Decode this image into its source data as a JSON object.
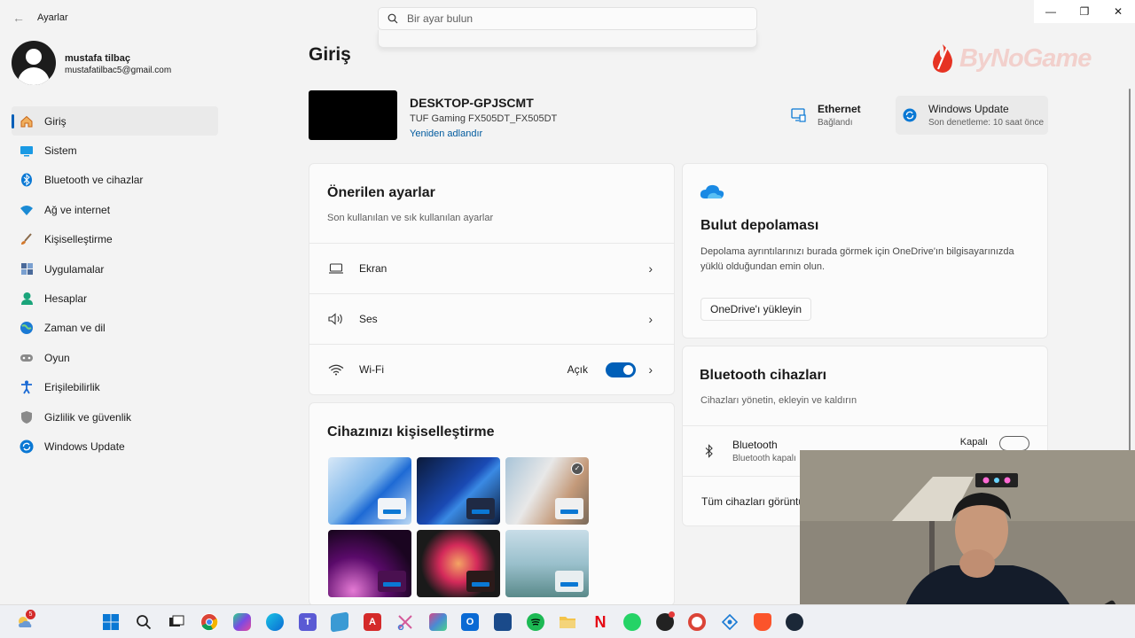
{
  "window": {
    "title": "Ayarlar",
    "back": "←",
    "min": "—",
    "max": "❐",
    "close": "✕"
  },
  "search": {
    "placeholder": "Bir ayar bulun"
  },
  "profile": {
    "name": "mustafa tilbaç",
    "email": "mustafatilbac5@gmail.com"
  },
  "sidebar": {
    "items": [
      {
        "label": "Giriş",
        "icon": "home-icon",
        "color": "#c86414"
      },
      {
        "label": "Sistem",
        "icon": "system-icon",
        "color": "#0a8ad4"
      },
      {
        "label": "Bluetooth ve cihazlar",
        "icon": "bluetooth-icon",
        "color": "#0a78d4"
      },
      {
        "label": "Ağ ve internet",
        "icon": "wifi-icon",
        "color": "#1a8ad4"
      },
      {
        "label": "Kişiselleştirme",
        "icon": "brush-icon",
        "color": "#d4782a"
      },
      {
        "label": "Uygulamalar",
        "icon": "apps-icon",
        "color": "#4a6a9a"
      },
      {
        "label": "Hesaplar",
        "icon": "account-icon",
        "color": "#1aa47a"
      },
      {
        "label": "Zaman ve dil",
        "icon": "globe-clock-icon",
        "color": "#1a7ad4"
      },
      {
        "label": "Oyun",
        "icon": "gamepad-icon",
        "color": "#8a8a8a"
      },
      {
        "label": "Erişilebilirlik",
        "icon": "accessibility-icon",
        "color": "#1a6ad4"
      },
      {
        "label": "Gizlilik ve güvenlik",
        "icon": "shield-icon",
        "color": "#7a7a7a"
      },
      {
        "label": "Windows Update",
        "icon": "update-icon",
        "color": "#0a78d4"
      }
    ]
  },
  "main": {
    "title": "Giriş",
    "device": {
      "name": "DESKTOP-GPJSCMT",
      "model": "TUF Gaming FX505DT_FX505DT",
      "rename": "Yeniden adlandır"
    },
    "ethernet": {
      "title": "Ethernet",
      "status": "Bağlandı"
    },
    "update": {
      "title": "Windows Update",
      "status": "Son denetleme: 10 saat önce"
    },
    "recommended": {
      "title": "Önerilen ayarlar",
      "subtitle": "Son kullanılan ve sık kullanılan ayarlar",
      "rows": {
        "screen": "Ekran",
        "sound": "Ses",
        "wifi": "Wi-Fi",
        "wifi_state": "Açık"
      }
    },
    "personalize": {
      "title": "Cihazınızı kişiselleştirme"
    },
    "cloud": {
      "title": "Bulut depolaması",
      "desc": "Depolama ayrıntılarınızı burada görmek için OneDrive'ın bilgisayarınızda yüklü olduğundan emin olun.",
      "button": "OneDrive'ı yükleyin"
    },
    "bluetooth": {
      "title": "Bluetooth cihazları",
      "subtitle": "Cihazları yönetin, ekleyin ve kaldırın",
      "device_title": "Bluetooth",
      "device_status": "Bluetooth kapalı",
      "toggle_label": "Kapalı",
      "view_all": "Tüm cihazları görüntü"
    }
  },
  "watermark": {
    "text": "ByNoGame"
  },
  "taskbar": {
    "notification_count": "5"
  }
}
